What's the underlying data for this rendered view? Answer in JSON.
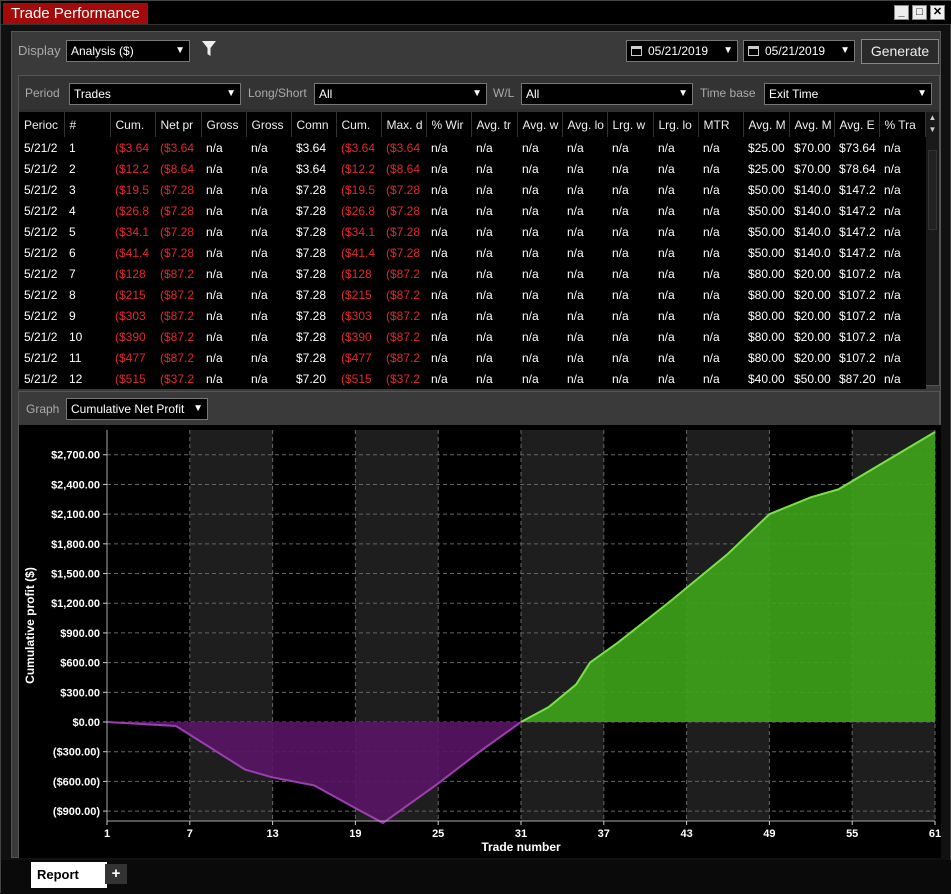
{
  "window": {
    "title": "Trade Performance",
    "controls": [
      "_",
      "□",
      "✕"
    ]
  },
  "toolbar": {
    "display_label": "Display",
    "display_value": "Analysis ($)",
    "filter_icon": "filter-icon",
    "date_from": "05/21/2019",
    "date_to": "05/21/2019",
    "generate_label": "Generate"
  },
  "filters": {
    "period_label": "Period",
    "period_value": "Trades",
    "longshort_label": "Long/Short",
    "longshort_value": "All",
    "wl_label": "W/L",
    "wl_value": "All",
    "timebase_label": "Time base",
    "timebase_value": "Exit Time"
  },
  "table": {
    "headers": [
      "Perioc",
      "#",
      "Cum.",
      "Net pr",
      "Gross",
      "Gross",
      "Comn",
      "Cum.",
      "Max. d",
      "% Wir",
      "Avg. tr",
      "Avg. w",
      "Avg. lo",
      "Lrg. w",
      "Lrg. lo",
      "MTR",
      "Avg. M",
      "Avg. M",
      "Avg. E",
      "% Tra"
    ],
    "rows": [
      [
        "5/21/2",
        "1",
        "($3.64",
        "($3.64",
        "n/a",
        "n/a",
        "$3.64",
        "($3.64",
        "($3.64",
        "n/a",
        "n/a",
        "n/a",
        "n/a",
        "n/a",
        "n/a",
        "n/a",
        "$25.00",
        "$70.00",
        "$73.64",
        "n/a"
      ],
      [
        "5/21/2",
        "2",
        "($12.2",
        "($8.64",
        "n/a",
        "n/a",
        "$3.64",
        "($12.2",
        "($8.64",
        "n/a",
        "n/a",
        "n/a",
        "n/a",
        "n/a",
        "n/a",
        "n/a",
        "$25.00",
        "$70.00",
        "$78.64",
        "n/a"
      ],
      [
        "5/21/2",
        "3",
        "($19.5",
        "($7.28",
        "n/a",
        "n/a",
        "$7.28",
        "($19.5",
        "($7.28",
        "n/a",
        "n/a",
        "n/a",
        "n/a",
        "n/a",
        "n/a",
        "n/a",
        "$50.00",
        "$140.0",
        "$147.2",
        "n/a"
      ],
      [
        "5/21/2",
        "4",
        "($26.8",
        "($7.28",
        "n/a",
        "n/a",
        "$7.28",
        "($26.8",
        "($7.28",
        "n/a",
        "n/a",
        "n/a",
        "n/a",
        "n/a",
        "n/a",
        "n/a",
        "$50.00",
        "$140.0",
        "$147.2",
        "n/a"
      ],
      [
        "5/21/2",
        "5",
        "($34.1",
        "($7.28",
        "n/a",
        "n/a",
        "$7.28",
        "($34.1",
        "($7.28",
        "n/a",
        "n/a",
        "n/a",
        "n/a",
        "n/a",
        "n/a",
        "n/a",
        "$50.00",
        "$140.0",
        "$147.2",
        "n/a"
      ],
      [
        "5/21/2",
        "6",
        "($41.4",
        "($7.28",
        "n/a",
        "n/a",
        "$7.28",
        "($41.4",
        "($7.28",
        "n/a",
        "n/a",
        "n/a",
        "n/a",
        "n/a",
        "n/a",
        "n/a",
        "$50.00",
        "$140.0",
        "$147.2",
        "n/a"
      ],
      [
        "5/21/2",
        "7",
        "($128",
        "($87.2",
        "n/a",
        "n/a",
        "$7.28",
        "($128",
        "($87.2",
        "n/a",
        "n/a",
        "n/a",
        "n/a",
        "n/a",
        "n/a",
        "n/a",
        "$80.00",
        "$20.00",
        "$107.2",
        "n/a"
      ],
      [
        "5/21/2",
        "8",
        "($215",
        "($87.2",
        "n/a",
        "n/a",
        "$7.28",
        "($215",
        "($87.2",
        "n/a",
        "n/a",
        "n/a",
        "n/a",
        "n/a",
        "n/a",
        "n/a",
        "$80.00",
        "$20.00",
        "$107.2",
        "n/a"
      ],
      [
        "5/21/2",
        "9",
        "($303",
        "($87.2",
        "n/a",
        "n/a",
        "$7.28",
        "($303",
        "($87.2",
        "n/a",
        "n/a",
        "n/a",
        "n/a",
        "n/a",
        "n/a",
        "n/a",
        "$80.00",
        "$20.00",
        "$107.2",
        "n/a"
      ],
      [
        "5/21/2",
        "10",
        "($390",
        "($87.2",
        "n/a",
        "n/a",
        "$7.28",
        "($390",
        "($87.2",
        "n/a",
        "n/a",
        "n/a",
        "n/a",
        "n/a",
        "n/a",
        "n/a",
        "$80.00",
        "$20.00",
        "$107.2",
        "n/a"
      ],
      [
        "5/21/2",
        "11",
        "($477",
        "($87.2",
        "n/a",
        "n/a",
        "$7.28",
        "($477",
        "($87.2",
        "n/a",
        "n/a",
        "n/a",
        "n/a",
        "n/a",
        "n/a",
        "n/a",
        "$80.00",
        "$20.00",
        "$107.2",
        "n/a"
      ],
      [
        "5/21/2",
        "12",
        "($515",
        "($37.2",
        "n/a",
        "n/a",
        "$7.20",
        "($515",
        "($37.2",
        "n/a",
        "n/a",
        "n/a",
        "n/a",
        "n/a",
        "n/a",
        "n/a",
        "$40.00",
        "$50.00",
        "$87.20",
        "n/a"
      ]
    ],
    "negative_cols": [
      2,
      3,
      7,
      8
    ]
  },
  "graph": {
    "label": "Graph",
    "value": "Cumulative Net Profit"
  },
  "chart_data": {
    "type": "area",
    "xlabel": "Trade number",
    "ylabel": "Cumulative profit ($)",
    "ylim": [
      -1000,
      2950
    ],
    "xlim": [
      1,
      61
    ],
    "xticks": [
      1,
      7,
      13,
      19,
      25,
      31,
      37,
      43,
      49,
      55,
      61
    ],
    "yticks": [
      -900,
      -600,
      -300,
      0,
      300,
      600,
      900,
      1200,
      1500,
      1800,
      2100,
      2400,
      2700
    ],
    "ytick_labels": [
      "($900.00)",
      "($600.00)",
      "($300.00)",
      "$0.00",
      "$300.00",
      "$600.00",
      "$900.00",
      "$1,200.00",
      "$1,500.00",
      "$1,800.00",
      "$2,100.00",
      "$2,400.00",
      "$2,700.00"
    ],
    "x": [
      1,
      6,
      11,
      13,
      16,
      19,
      21,
      25,
      28,
      31,
      33,
      35,
      36,
      38,
      42,
      46,
      49,
      52,
      54,
      61
    ],
    "y": [
      0,
      -40,
      -480,
      -560,
      -640,
      -870,
      -1020,
      -620,
      -300,
      0,
      150,
      380,
      600,
      800,
      1240,
      1700,
      2100,
      2270,
      2350,
      2930
    ],
    "band_color": "#1e1e1e",
    "positive_color": "#3ea419",
    "negative_color": "#5a1466"
  },
  "tabs": {
    "report_label": "Report",
    "add_label": "+"
  }
}
